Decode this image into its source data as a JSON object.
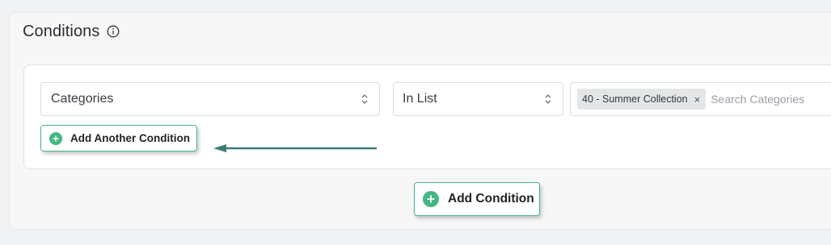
{
  "panel": {
    "title": "Conditions",
    "info_icon": "info-circle-icon"
  },
  "condition": {
    "field_select": {
      "value": "Categories"
    },
    "operator_select": {
      "value": "In List"
    },
    "values": {
      "tags": [
        {
          "label": "40 - Summer Collection",
          "remove_symbol": "×"
        }
      ],
      "search_placeholder": "Search Categories"
    },
    "add_another_label": "Add Another Condition"
  },
  "add_condition_label": "Add Condition",
  "colors": {
    "accent": "#42b883",
    "arrow": "#3d7d76"
  }
}
